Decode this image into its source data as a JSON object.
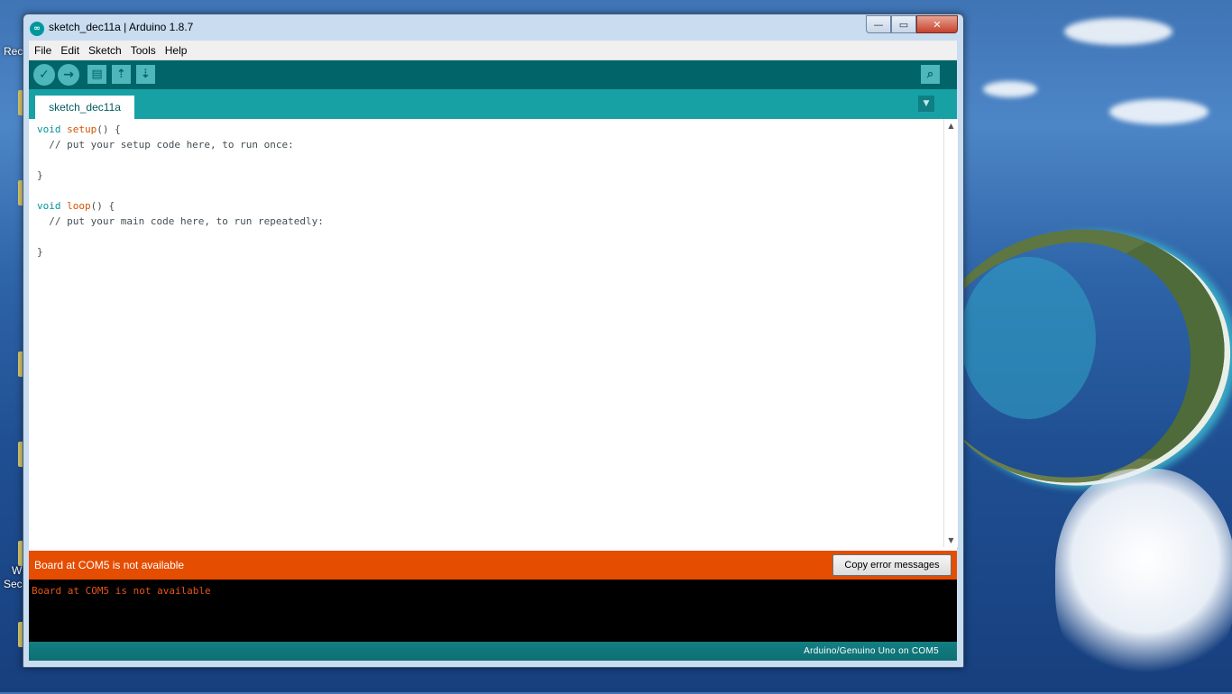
{
  "window": {
    "title": "sketch_dec11a | Arduino 1.8.7",
    "controls": {
      "minimize": "—",
      "maximize": "▭",
      "close": "✕"
    }
  },
  "menu": [
    "File",
    "Edit",
    "Sketch",
    "Tools",
    "Help"
  ],
  "toolbar": {
    "verify_icon": "✓",
    "upload_icon": "→",
    "new_icon": "▤",
    "open_icon": "⇡",
    "save_icon": "⇣",
    "serial_monitor_icon": "⌕"
  },
  "tabs": [
    {
      "label": "sketch_dec11a"
    }
  ],
  "tab_menu_icon": "▼",
  "editor": {
    "lines": [
      {
        "kw": "void",
        "fn": "setup",
        "rest": "() {"
      },
      {
        "comment": "  // put your setup code here, to run once:"
      },
      {
        "text": ""
      },
      {
        "text": "}"
      },
      {
        "text": ""
      },
      {
        "kw": "void",
        "fn": "loop",
        "rest": "() {"
      },
      {
        "comment": "  // put your main code here, to run repeatedly:"
      },
      {
        "text": ""
      },
      {
        "text": "}"
      }
    ]
  },
  "error_bar": {
    "message": "Board at COM5 is not available",
    "copy_button": "Copy error messages",
    "color": "#e54d00"
  },
  "console": {
    "output": "Board at COM5 is not available"
  },
  "status_bar": {
    "board": "Arduino/Genuino Uno on COM5"
  },
  "theme": {
    "teal_dark": "#006468",
    "teal": "#17a1a5",
    "keyword": "#00979c",
    "function": "#d35400"
  },
  "desktop_labels": [
    "Rec",
    "W",
    "Sec"
  ]
}
